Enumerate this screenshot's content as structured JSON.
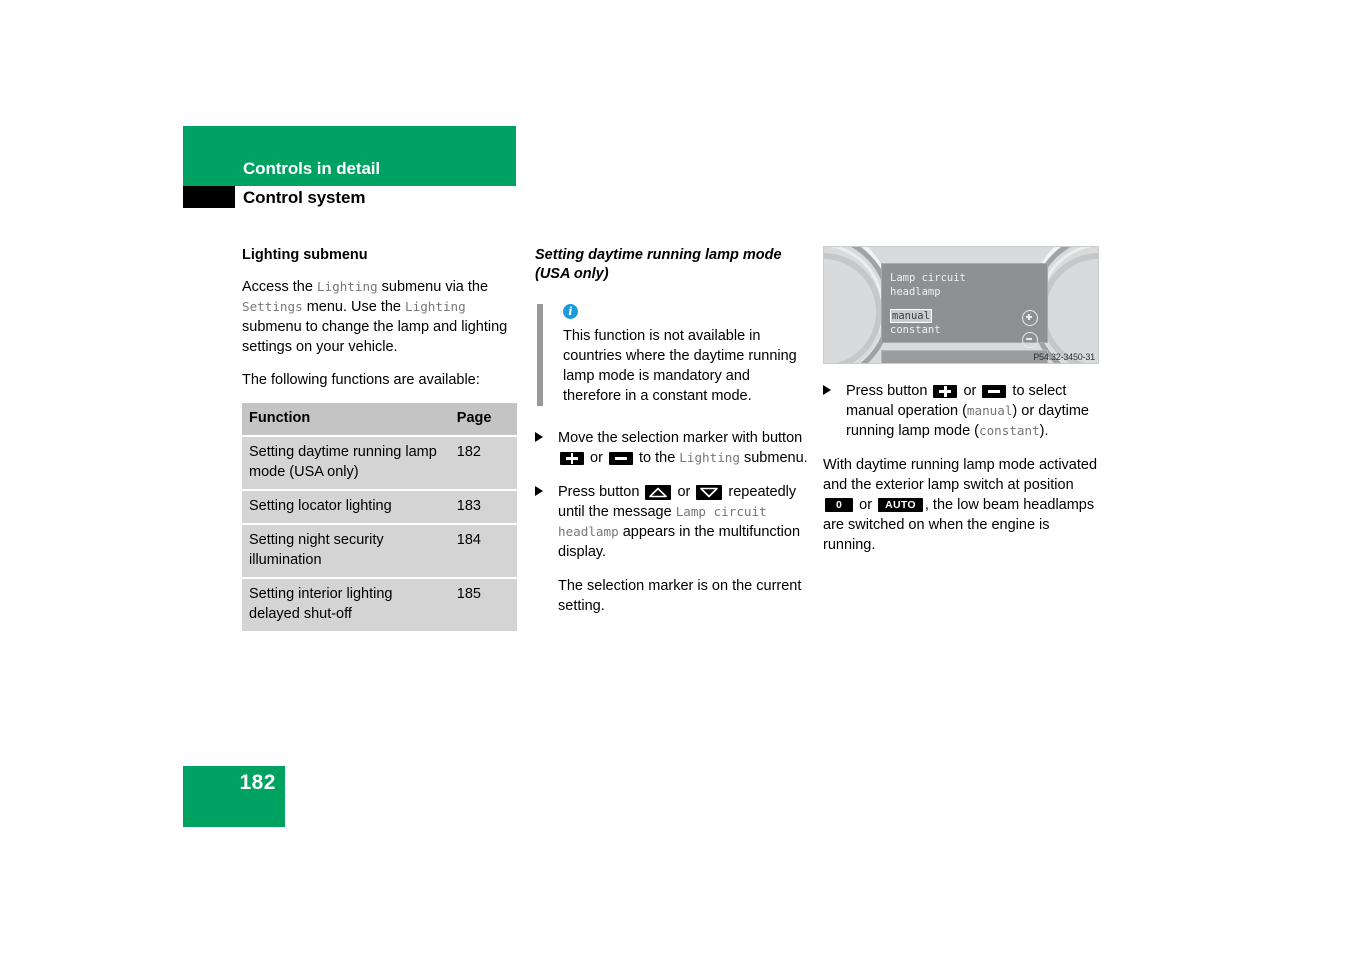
{
  "header": {
    "chapter_title": "Controls in detail",
    "section_title": "Control system",
    "green_color": "#00a262"
  },
  "footer": {
    "page_number": "182"
  },
  "left_column": {
    "heading": "Lighting submenu",
    "para1_part1": "Access the ",
    "para1_mono1": "Lighting",
    "para1_part2": " submenu via the ",
    "para1_mono2": "Settings",
    "para1_part3": " menu. Use the ",
    "para1_mono3": "Lighting",
    "para1_part4": " submenu to change the lamp and lighting settings on your vehicle.",
    "para2": "The following functions are available:",
    "table": {
      "headers": [
        "Function",
        "Page"
      ],
      "rows": [
        {
          "function": "Setting daytime running lamp mode (USA only)",
          "page": "182"
        },
        {
          "function": "Setting locator lighting",
          "page": "183"
        },
        {
          "function": "Setting night security illumination",
          "page": "184"
        },
        {
          "function": "Setting interior lighting delayed shut-off",
          "page": "185"
        }
      ]
    }
  },
  "middle_column": {
    "heading": "Setting daytime running lamp mode (USA only)",
    "note": {
      "icon": "info-icon",
      "icon_glyph": "i",
      "icon_color": "#1a9bdc",
      "text": "This function is not available in countries where the daytime running lamp mode is mandatory and therefore in a constant mode."
    },
    "step1": {
      "part1": "Move the selection marker with button ",
      "button_a": "plus-button",
      "or": " or ",
      "button_b": "minus-button",
      "part2": " to the ",
      "mono": "Lighting",
      "part3": " submenu."
    },
    "step2": {
      "part1": "Press button ",
      "button_a": "up-arrow-button",
      "or": " or ",
      "button_b": "down-arrow-button",
      "part2": " repeatedly until the message ",
      "mono": "Lamp circuit headlamp",
      "part3": " appears in the multifunction display."
    },
    "step2_sub": "The selection marker is on the current setting."
  },
  "right_column": {
    "figure": {
      "code": "P54.32-3450-31",
      "display": {
        "line1": "Lamp circuit",
        "line2": "headlamp",
        "option_selected": "manual",
        "option_other": "constant",
        "icon_plus": "plus-circle-icon",
        "icon_minus": "minus-circle-icon"
      }
    },
    "step1": {
      "part1": "Press button ",
      "button_a": "plus-button",
      "or": " or ",
      "button_b": "minus-button",
      "part2": " to select manual operation (",
      "mono1": "manual",
      "part3": ") or daytime running lamp mode (",
      "mono2": "constant",
      "part4": ")."
    },
    "para": {
      "part1": "With daytime running lamp mode activated and the exterior lamp switch at position ",
      "badge_a": "0",
      "or": " or ",
      "badge_b": "AUTO",
      "part2": ", the low beam headlamps are switched on when the engine is running."
    }
  }
}
